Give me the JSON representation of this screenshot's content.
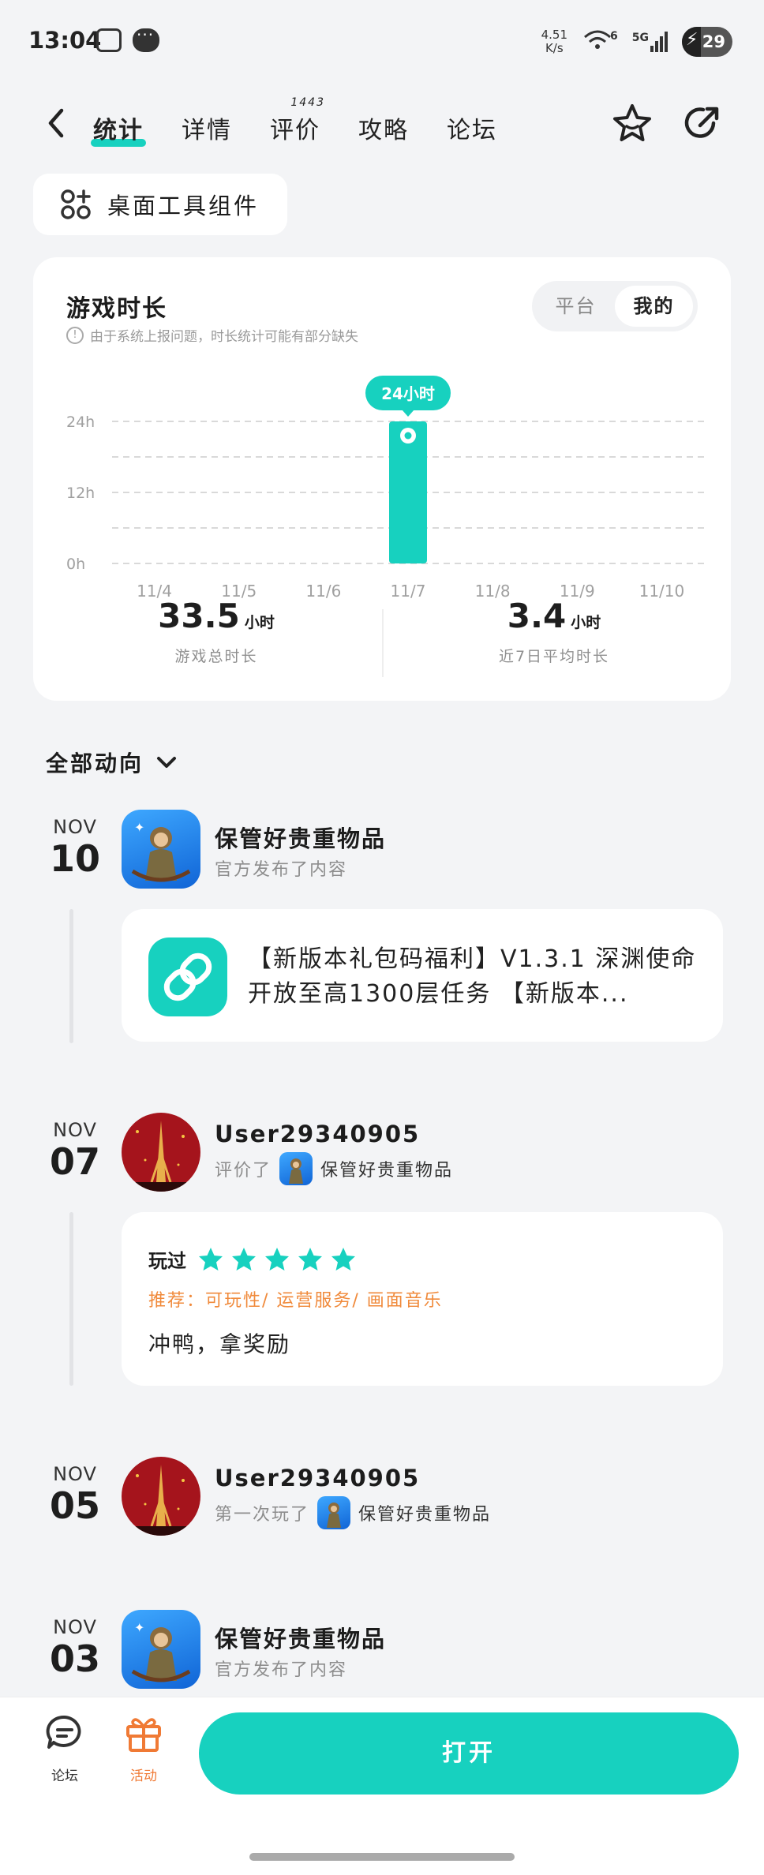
{
  "status_bar": {
    "time": "13:04",
    "net_speed_value": "4.51",
    "net_speed_unit": "K/s",
    "signal": "5G",
    "wifi_label": "6",
    "battery": "29"
  },
  "header": {
    "tabs": [
      {
        "label": "统计",
        "active": true
      },
      {
        "label": "详情"
      },
      {
        "label": "评价",
        "badge": "1443"
      },
      {
        "label": "攻略"
      },
      {
        "label": "论坛"
      }
    ]
  },
  "widget_button": {
    "label": "桌面工具组件"
  },
  "chart_card": {
    "title": "游戏时长",
    "note": "由于系统上报问题，时长统计可能有部分缺失",
    "toggle": {
      "options": [
        "平台",
        "我的"
      ],
      "selected": "我的"
    },
    "stats": [
      {
        "value": "33.5",
        "unit": "小时",
        "label": "游戏总时长"
      },
      {
        "value": "3.4",
        "unit": "小时",
        "label": "近7日平均时长"
      }
    ]
  },
  "chart_data": {
    "type": "bar",
    "categories": [
      "11/4",
      "11/5",
      "11/6",
      "11/7",
      "11/8",
      "11/9",
      "11/10"
    ],
    "values": [
      0,
      0,
      0,
      24,
      0,
      0,
      0
    ],
    "y_ticks": [
      "0h",
      "12h",
      "24h"
    ],
    "ylim": [
      0,
      24
    ],
    "highlight_label": "24小时",
    "highlight_index": 3,
    "grid": true,
    "color": "#17d1bf"
  },
  "feed": {
    "filter_label": "全部动向",
    "items": [
      {
        "month": "NOV",
        "day": "10",
        "name": "保管好贵重物品",
        "sub": "官方发布了内容",
        "card_text": "【新版本礼包码福利】V1.3.1 深渊使命开放至高1300层任务 【新版本..."
      },
      {
        "month": "NOV",
        "day": "07",
        "name": "User29340905",
        "sub": "评价了",
        "game": "保管好贵重物品",
        "review": {
          "label": "玩过",
          "stars": 5,
          "tags": "推荐：可玩性/ 运营服务/ 画面音乐",
          "text": "冲鸭，拿奖励"
        }
      },
      {
        "month": "NOV",
        "day": "05",
        "name": "User29340905",
        "sub": "第一次玩了",
        "game": "保管好贵重物品"
      },
      {
        "month": "NOV",
        "day": "03",
        "name": "保管好贵重物品",
        "sub": "官方发布了内容"
      }
    ]
  },
  "bottom_bar": {
    "forum_label": "论坛",
    "activity_label": "活动",
    "open_label": "打开"
  }
}
